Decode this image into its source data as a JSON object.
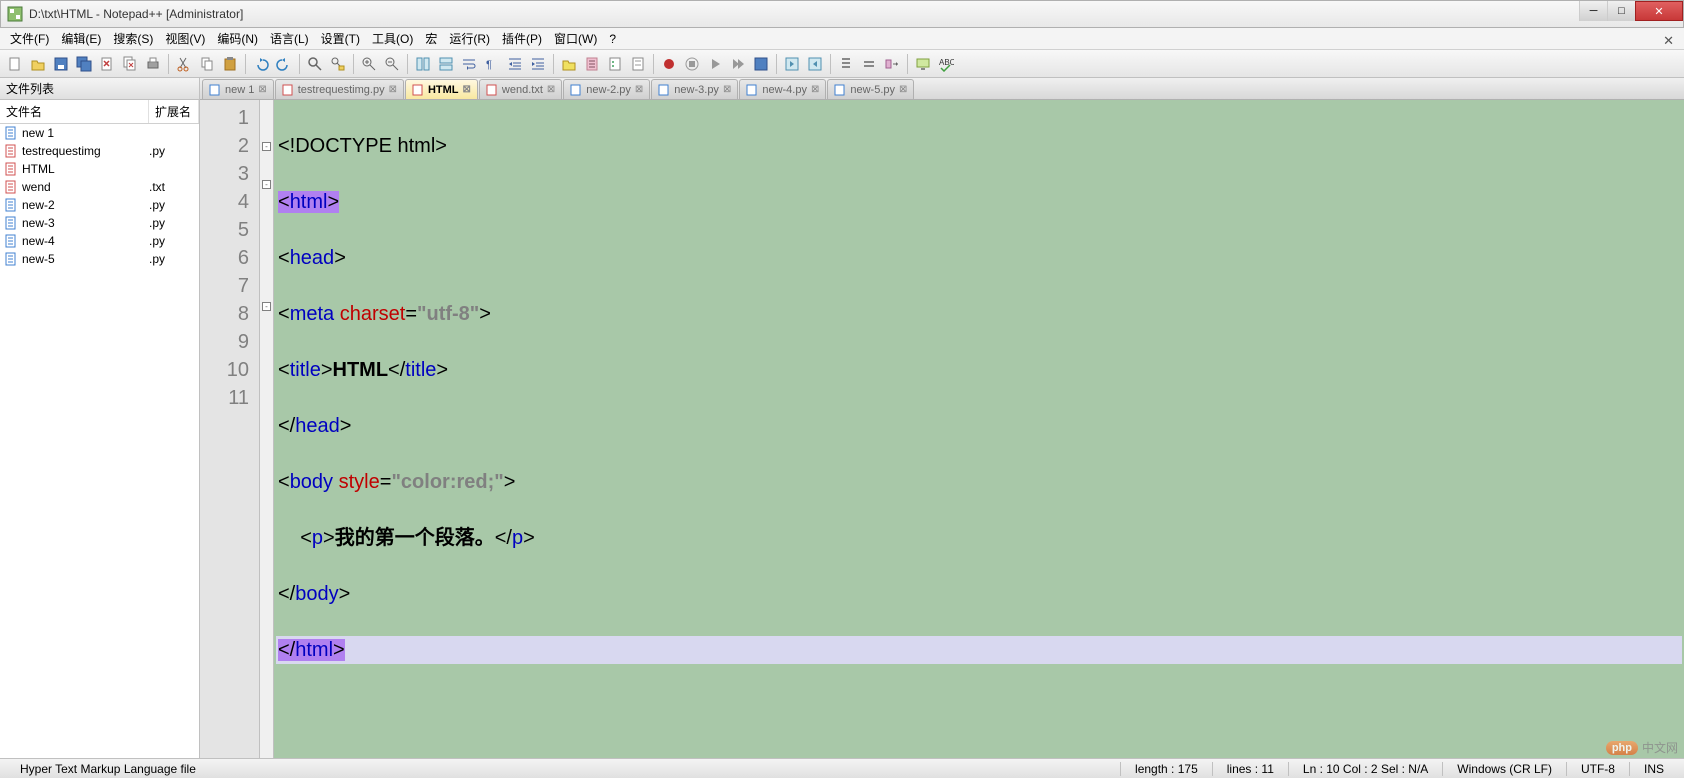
{
  "window": {
    "title": "D:\\txt\\HTML - Notepad++ [Administrator]"
  },
  "menu": {
    "items": [
      "文件(F)",
      "编辑(E)",
      "搜索(S)",
      "视图(V)",
      "编码(N)",
      "语言(L)",
      "设置(T)",
      "工具(O)",
      "宏",
      "运行(R)",
      "插件(P)",
      "窗口(W)",
      "?"
    ]
  },
  "sidebar": {
    "title": "文件列表",
    "col_name": "文件名",
    "col_ext": "扩展名",
    "files": [
      {
        "name": "new 1",
        "ext": "",
        "color": "#4080d0"
      },
      {
        "name": "testrequestimg",
        "ext": ".py",
        "color": "#d05050"
      },
      {
        "name": "HTML",
        "ext": "",
        "color": "#d05050"
      },
      {
        "name": "wend",
        "ext": ".txt",
        "color": "#d05050"
      },
      {
        "name": "new-2",
        "ext": ".py",
        "color": "#4080d0"
      },
      {
        "name": "new-3",
        "ext": ".py",
        "color": "#4080d0"
      },
      {
        "name": "new-4",
        "ext": ".py",
        "color": "#4080d0"
      },
      {
        "name": "new-5",
        "ext": ".py",
        "color": "#4080d0"
      }
    ]
  },
  "tabs": [
    {
      "label": "new 1",
      "active": false,
      "color": "#4080d0"
    },
    {
      "label": "testrequestimg.py",
      "active": false,
      "color": "#d05050"
    },
    {
      "label": "HTML",
      "active": true,
      "color": "#d05050"
    },
    {
      "label": "wend.txt",
      "active": false,
      "color": "#d05050"
    },
    {
      "label": "new-2.py",
      "active": false,
      "color": "#4080d0"
    },
    {
      "label": "new-3.py",
      "active": false,
      "color": "#4080d0"
    },
    {
      "label": "new-4.py",
      "active": false,
      "color": "#4080d0"
    },
    {
      "label": "new-5.py",
      "active": false,
      "color": "#4080d0"
    }
  ],
  "code": {
    "line_count": 11,
    "lines": {
      "l1": "<!DOCTYPE html>",
      "l2_open": "<",
      "l2_tag": "html",
      "l2_close": ">",
      "l3_open": "<",
      "l3_tag": "head",
      "l3_close": ">",
      "l4_open": "<",
      "l4_tag": "meta",
      "l4_attr": " charset",
      "l4_eq": "=",
      "l4_val": "\"utf-8\"",
      "l4_close": ">",
      "l5_open": "<",
      "l5_tag": "title",
      "l5_close": ">",
      "l5_text": "HTML",
      "l5_open2": "</",
      "l5_tag2": "title",
      "l5_close2": ">",
      "l6_open": "</",
      "l6_tag": "head",
      "l6_close": ">",
      "l7_open": "<",
      "l7_tag": "body",
      "l7_attr": " style",
      "l7_eq": "=",
      "l7_val": "\"color:red;\"",
      "l7_close": ">",
      "l8_indent": "    ",
      "l8_open": "<",
      "l8_tag": "p",
      "l8_close": ">",
      "l8_text": "我的第一个段落。",
      "l8_open2": "</",
      "l8_tag2": "p",
      "l8_close2": ">",
      "l9_open": "</",
      "l9_tag": "body",
      "l9_close": ">",
      "l10_open": "</",
      "l10_tag": "html",
      "l10_close": ">"
    }
  },
  "status": {
    "filetype": "Hyper Text Markup Language file",
    "length": "length : 175",
    "lines": "lines : 11",
    "pos": "Ln : 10    Col : 2    Sel : N/A",
    "eol": "Windows (CR LF)",
    "enc": "UTF-8",
    "mode": "INS"
  },
  "watermark": {
    "badge": "php",
    "text": "中文网"
  }
}
